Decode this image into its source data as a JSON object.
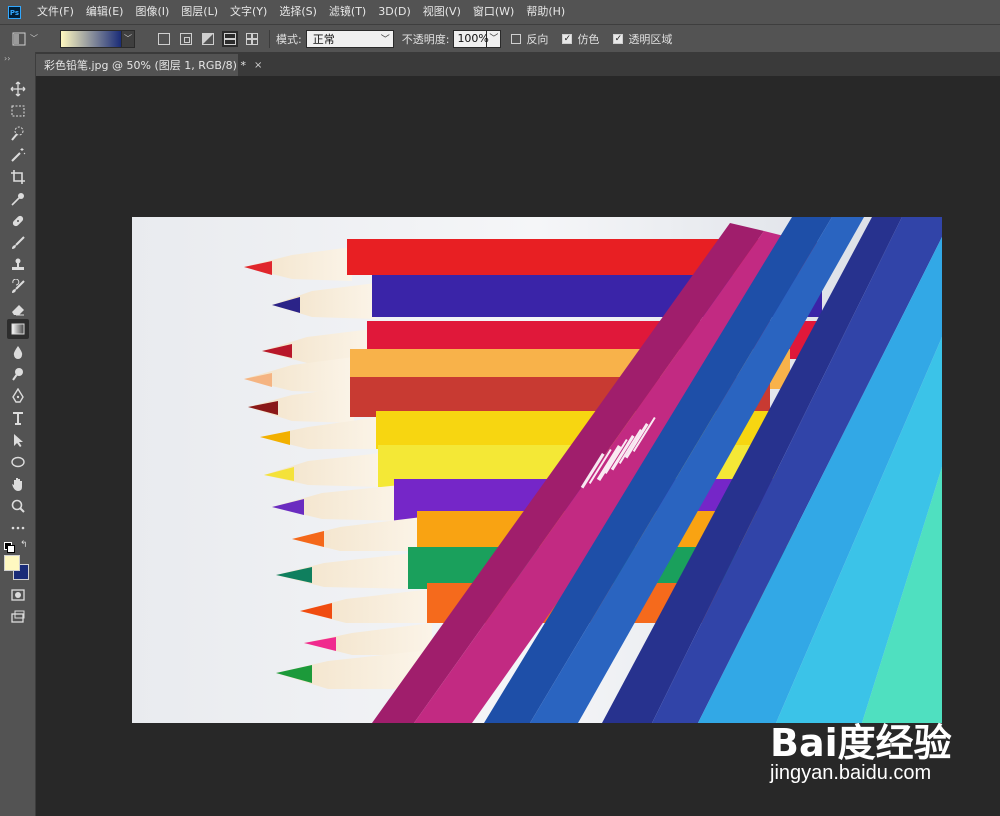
{
  "app": {
    "logo_text": "Ps"
  },
  "menu": [
    "文件(F)",
    "编辑(E)",
    "图像(I)",
    "图层(L)",
    "文字(Y)",
    "选择(S)",
    "滤镜(T)",
    "3D(D)",
    "视图(V)",
    "窗口(W)",
    "帮助(H)"
  ],
  "options": {
    "gradient_colors": [
      "#fff8c0",
      "#1a2c78"
    ],
    "mode_label": "模式:",
    "mode_value": "正常",
    "opacity_label": "不透明度:",
    "opacity_value": "100%",
    "reverse_label": "反向",
    "reverse_checked": false,
    "dither_label": "仿色",
    "dither_checked": true,
    "transparency_label": "透明区域",
    "transparency_checked": true
  },
  "document": {
    "tab_title": "彩色铅笔.jpg @ 50% (图层 1, RGB/8) *",
    "close_glyph": "×"
  },
  "toolbar": {
    "active_tool": "gradient-tool",
    "foreground_color": "#fff8c0",
    "background_color": "#1a2c78"
  },
  "watermark": {
    "logo": "Bai度经验",
    "url": "jingyan.baidu.com"
  }
}
